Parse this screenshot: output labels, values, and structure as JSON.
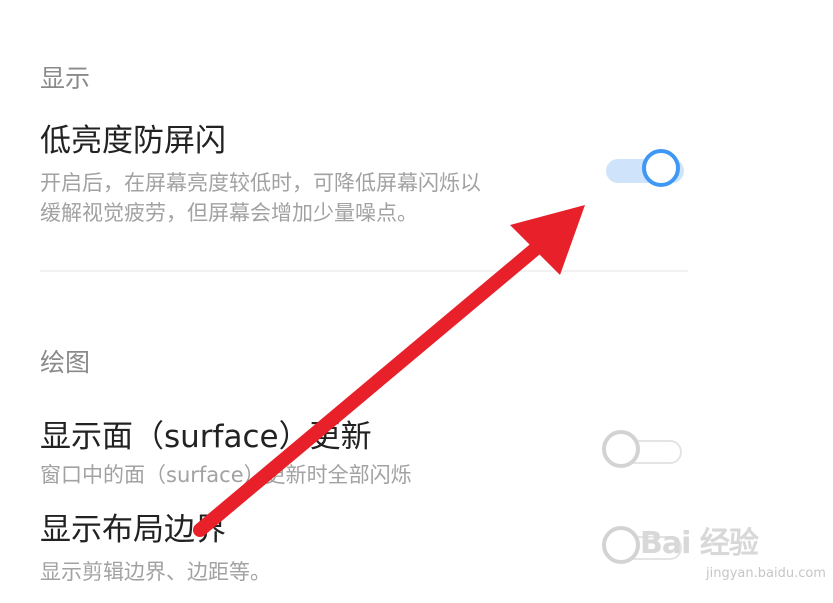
{
  "display_section": {
    "title": "显示",
    "low_brightness_flicker": {
      "title": "低亮度防屏闪",
      "description_line1": "开启后，在屏幕亮度较低时，可降低屏幕闪烁以",
      "description_line2": "缓解视觉疲劳，但屏幕会增加少量噪点。",
      "enabled": true
    }
  },
  "drawing_section": {
    "title": "绘图",
    "show_surface_updates": {
      "title": "显示面（surface）更新",
      "description": "窗口中的面（surface）更新时全部闪烁",
      "enabled": false
    },
    "show_layout_bounds": {
      "title": "显示布局边界",
      "description": "显示剪辑边界、边距等。",
      "enabled": false
    }
  },
  "annotation": {
    "arrow_color": "#e8202a"
  },
  "watermark": {
    "logo": "Bai 经验",
    "site": "jingyan.baidu.com"
  },
  "colors": {
    "toggle_on": "#3f98f5",
    "toggle_on_track": "#cfe4fb",
    "toggle_off": "#d3d3d3"
  }
}
